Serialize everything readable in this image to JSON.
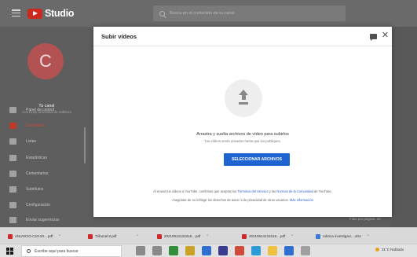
{
  "app": {
    "logo_text": "Studio",
    "search_placeholder": "Busca en el contenido de tu canal"
  },
  "sidebar": {
    "avatar_letter": "C",
    "channel_title": "Tu canal",
    "channel_subtitle": "Con Dosp Universitat de València",
    "items": [
      {
        "label": "Panel de control",
        "icon": "dashboard-icon",
        "active": false
      },
      {
        "label": "Contenido",
        "icon": "content-icon",
        "active": true
      },
      {
        "label": "Listas",
        "icon": "playlists-icon",
        "active": false
      },
      {
        "label": "Estadísticas",
        "icon": "analytics-icon",
        "active": false
      },
      {
        "label": "Comentarios",
        "icon": "comments-icon",
        "active": false
      },
      {
        "label": "Subtítulos",
        "icon": "subtitles-icon",
        "active": false
      },
      {
        "label": "Configuración",
        "icon": "settings-icon",
        "active": false
      },
      {
        "label": "Enviar sugerencias",
        "icon": "feedback-icon",
        "active": false
      }
    ]
  },
  "background": {
    "pager_text": "Filas por página: 30"
  },
  "modal": {
    "title": "Subir vídeos",
    "drop_title": "Arrastra y suelta archivos de vídeo para subirlos",
    "drop_subtitle": "Tus vídeos serán privados hasta que los publiques.",
    "select_button": "SELECCIONAR ARCHIVOS",
    "legal_line1_prefix": "Al enviar tus vídeos a YouTube, confirmas que aceptas los",
    "legal_terms_link": "Términos del Servicio",
    "legal_and": "y las",
    "legal_community_link": "Normas de la Comunidad",
    "legal_line1_suffix": "de YouTube.",
    "legal_line2_prefix": "Asegúrate de no infringir los derechos de autor ni de privacidad de otros usuarios.",
    "legal_more_link": "Más información"
  },
  "downloads": [
    {
      "name": "ANUNCIO-C23-20....pdf",
      "type": "pdf"
    },
    {
      "name": "Tribunal 8.pdf",
      "type": "pdf"
    },
    {
      "name": "20210914131518....pdf",
      "type": "pdf"
    },
    {
      "name": "20210914131518....pdf",
      "type": "pdf"
    },
    {
      "name": "rubrica investigaci....xlsx",
      "type": "other"
    }
  ],
  "taskbar": {
    "search_placeholder": "Escribe aquí para buscar",
    "weather": "31°C Nublado",
    "app_colors": [
      "#8a8a8a",
      "#8a8a8a",
      "#2f8f3a",
      "#c9a227",
      "#2f6fd0",
      "#3b3b8f",
      "#d04a3a",
      "#2d9bd6",
      "#f0c040",
      "#2f6fd0",
      "#a0a0a0"
    ]
  },
  "colors": {
    "accent": "#1f63d1",
    "youtube_red": "#cc2a1e",
    "active_nav": "#d24a3a"
  }
}
